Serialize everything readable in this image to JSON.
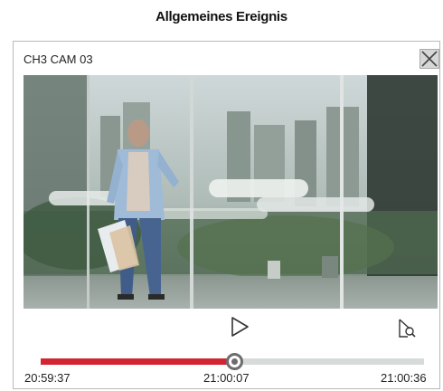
{
  "dialog": {
    "heading": "Allgemeines Ereignis",
    "camera_title": "CH3 CAM 03"
  },
  "icons": {
    "close": "close-icon",
    "play": "play-icon",
    "search": "search-magnifier-icon"
  },
  "playback": {
    "progress": 0.505,
    "start_time": "20:59:37",
    "current_time": "21:00:07",
    "end_time": "21:00:36"
  },
  "colors": {
    "progress_fill": "#d12631",
    "track": "#d6dbd8",
    "knob": "#6d6d6d"
  }
}
